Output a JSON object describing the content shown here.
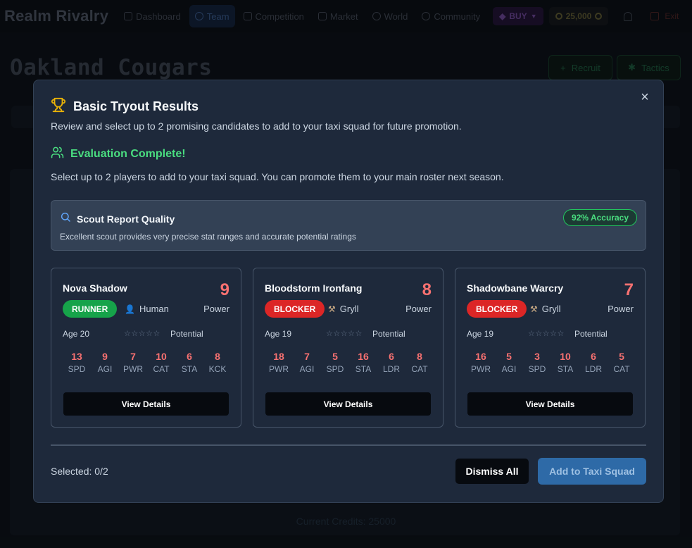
{
  "app": {
    "logo": "Realm Rivalry",
    "nav": [
      {
        "label": "Dashboard",
        "icon": "home-icon"
      },
      {
        "label": "Team",
        "icon": "users-icon"
      },
      {
        "label": "Competition",
        "icon": "trophy-icon"
      },
      {
        "label": "Market",
        "icon": "cart-icon"
      },
      {
        "label": "World",
        "icon": "globe-icon"
      },
      {
        "label": "Community",
        "icon": "chat-icon"
      }
    ],
    "active_nav": "Team",
    "buy_label": "BUY",
    "credits": "25,000",
    "exit_label": "Exit"
  },
  "page": {
    "team_name": "Oakland Cougars",
    "recruit_label": "Recruit",
    "tactics_label": "Tactics",
    "footer_credits": "Current Credits: 25000"
  },
  "modal": {
    "title": "Basic Tryout Results",
    "subtitle": "Review and select up to 2 promising candidates to add to your taxi squad for future promotion.",
    "eval_title": "Evaluation Complete!",
    "eval_desc": "Select up to 2 players to add to your taxi squad. You can promote them to your main roster next season.",
    "scout": {
      "title": "Scout Report Quality",
      "description": "Excellent scout provides very precise stat ranges and accurate potential ratings",
      "accuracy": "92% Accuracy"
    },
    "candidates": [
      {
        "name": "Nova Shadow",
        "power": "9",
        "power_label": "Power",
        "position": "RUNNER",
        "position_color": "#16a34a",
        "race": "Human",
        "race_icon": "person-icon",
        "age": "Age 20",
        "stars": "☆☆☆☆☆",
        "potential_label": "Potential",
        "stats": [
          {
            "value": "13",
            "label": "SPD"
          },
          {
            "value": "9",
            "label": "AGI"
          },
          {
            "value": "7",
            "label": "PWR"
          },
          {
            "value": "10",
            "label": "CAT"
          },
          {
            "value": "6",
            "label": "STA"
          },
          {
            "value": "8",
            "label": "KCK"
          }
        ],
        "button": "View Details"
      },
      {
        "name": "Bloodstorm Ironfang",
        "power": "8",
        "power_label": "Power",
        "position": "BLOCKER",
        "position_color": "#dc2626",
        "race": "Gryll",
        "race_icon": "hammer-icon",
        "age": "Age 19",
        "stars": "☆☆☆☆☆",
        "potential_label": "Potential",
        "stats": [
          {
            "value": "18",
            "label": "PWR"
          },
          {
            "value": "7",
            "label": "AGI"
          },
          {
            "value": "5",
            "label": "SPD"
          },
          {
            "value": "16",
            "label": "STA"
          },
          {
            "value": "6",
            "label": "LDR"
          },
          {
            "value": "8",
            "label": "CAT"
          }
        ],
        "button": "View Details"
      },
      {
        "name": "Shadowbane Warcry",
        "power": "7",
        "power_label": "Power",
        "position": "BLOCKER",
        "position_color": "#dc2626",
        "race": "Gryll",
        "race_icon": "hammer-icon",
        "age": "Age 19",
        "stars": "☆☆☆☆☆",
        "potential_label": "Potential",
        "stats": [
          {
            "value": "16",
            "label": "PWR"
          },
          {
            "value": "5",
            "label": "AGI"
          },
          {
            "value": "3",
            "label": "SPD"
          },
          {
            "value": "10",
            "label": "STA"
          },
          {
            "value": "6",
            "label": "LDR"
          },
          {
            "value": "5",
            "label": "CAT"
          }
        ],
        "button": "View Details"
      }
    ],
    "selected_text": "Selected: 0/2",
    "dismiss_label": "Dismiss All",
    "add_label": "Add to Taxi Squad"
  }
}
